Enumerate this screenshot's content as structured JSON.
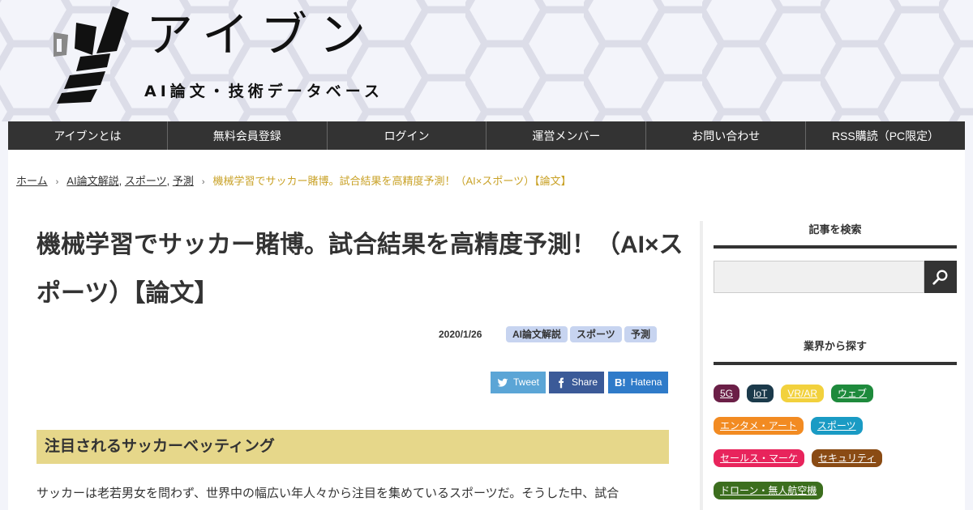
{
  "site": {
    "title": "アイブン",
    "subtitle": "AI論文・技術データベース"
  },
  "nav": [
    {
      "label": "アイブンとは"
    },
    {
      "label": "無料会員登録"
    },
    {
      "label": "ログイン"
    },
    {
      "label": "運営メンバー"
    },
    {
      "label": "お問い合わせ"
    },
    {
      "label": "RSS購読（PC限定）"
    }
  ],
  "breadcrumb": {
    "home": "ホーム",
    "categories": [
      "AI論文解説",
      "スポーツ",
      "予測"
    ],
    "current": "機械学習でサッカー賭博。試合結果を高精度予測！（AI×スポーツ）【論文】"
  },
  "article": {
    "title": "機械学習でサッカー賭博。試合結果を高精度予測！（AI×スポーツ）【論文】",
    "date": "2020/1/26",
    "tags": [
      "AI論文解説",
      "スポーツ",
      "予測"
    ],
    "share": {
      "tweet": "Tweet",
      "facebook": "Share",
      "hatena": "Hatena"
    },
    "section_heading": "注目されるサッカーベッティング",
    "body": "サッカーは老若男女を問わず、世界中の幅広い年人々から注目を集めているスポーツだ。そうした中、試合"
  },
  "sidebar": {
    "search_title": "記事を検索",
    "industry_title": "業界から探す",
    "industries": [
      [
        {
          "label": "5G",
          "color": "#6b1f47"
        },
        {
          "label": "IoT",
          "color": "#1b3a4b"
        },
        {
          "label": "VR/AR",
          "color": "#f2d13d"
        },
        {
          "label": "ウェブ",
          "color": "#1e8a3c"
        }
      ],
      [
        {
          "label": "エンタメ・アート",
          "color": "#f28b22"
        },
        {
          "label": "スポーツ",
          "color": "#1a9bc4"
        }
      ],
      [
        {
          "label": "セールス・マーケ",
          "color": "#e8245c"
        },
        {
          "label": "セキュリティ",
          "color": "#8a4b14"
        }
      ],
      [
        {
          "label": "ドローン・無人航空機",
          "color": "#3c6e1e"
        }
      ]
    ]
  },
  "colors": {
    "nav_bg": "#333333",
    "accent_gold": "#c9a227",
    "section_bg": "#e6d78a",
    "tag_bg": "#c7d4f0",
    "twitter": "#5ba5d6",
    "facebook": "#3b5a98",
    "hatena": "#2f7bc9"
  }
}
